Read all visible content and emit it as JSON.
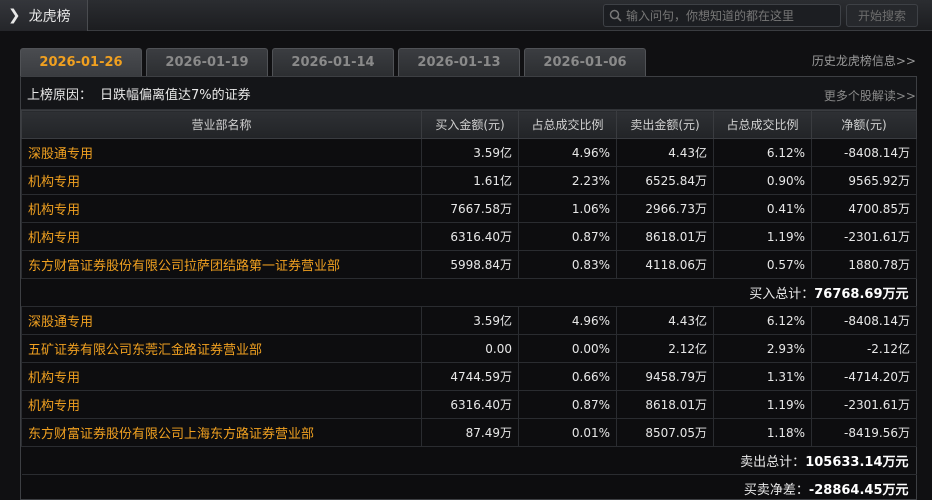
{
  "app": {
    "title": "龙虎榜"
  },
  "search": {
    "placeholder": "输入问句，你想知道的都在这里",
    "button": "开始搜索"
  },
  "tabs": [
    {
      "label": "2026-01-26",
      "active": true
    },
    {
      "label": "2026-01-19",
      "active": false
    },
    {
      "label": "2026-01-14",
      "active": false
    },
    {
      "label": "2026-01-13",
      "active": false
    },
    {
      "label": "2026-01-06",
      "active": false
    }
  ],
  "history_link": "历史龙虎榜信息>>",
  "reason": {
    "label": "上榜原因：",
    "value": "日跌幅偏离值达7%的证券"
  },
  "more_link": "更多个股解读>>",
  "columns": [
    "营业部名称",
    "买入金额(元)",
    "占总成交比例",
    "卖出金额(元)",
    "占总成交比例",
    "净额(元)"
  ],
  "buy_rows": [
    [
      "深股通专用",
      "3.59亿",
      "4.96%",
      "4.43亿",
      "6.12%",
      "-8408.14万"
    ],
    [
      "机构专用",
      "1.61亿",
      "2.23%",
      "6525.84万",
      "0.90%",
      "9565.92万"
    ],
    [
      "机构专用",
      "7667.58万",
      "1.06%",
      "2966.73万",
      "0.41%",
      "4700.85万"
    ],
    [
      "机构专用",
      "6316.40万",
      "0.87%",
      "8618.01万",
      "1.19%",
      "-2301.61万"
    ],
    [
      "东方财富证券股份有限公司拉萨团结路第一证券营业部",
      "5998.84万",
      "0.83%",
      "4118.06万",
      "0.57%",
      "1880.78万"
    ]
  ],
  "buy_total": {
    "label": "买入总计：",
    "value": "76768.69万元"
  },
  "sell_rows": [
    [
      "深股通专用",
      "3.59亿",
      "4.96%",
      "4.43亿",
      "6.12%",
      "-8408.14万"
    ],
    [
      "五矿证券有限公司东莞汇金路证券营业部",
      "0.00",
      "0.00%",
      "2.12亿",
      "2.93%",
      "-2.12亿"
    ],
    [
      "机构专用",
      "4744.59万",
      "0.66%",
      "9458.79万",
      "1.31%",
      "-4714.20万"
    ],
    [
      "机构专用",
      "6316.40万",
      "0.87%",
      "8618.01万",
      "1.19%",
      "-2301.61万"
    ],
    [
      "东方财富证券股份有限公司上海东方路证券营业部",
      "87.49万",
      "0.01%",
      "8507.05万",
      "1.18%",
      "-8419.56万"
    ]
  ],
  "sell_total": {
    "label": "卖出总计：",
    "value": "105633.14万元"
  },
  "net_total": {
    "label": "买卖净差：",
    "value": "-28864.45万元"
  },
  "colors": {
    "accent": "#f0a020",
    "background": "#101012"
  }
}
